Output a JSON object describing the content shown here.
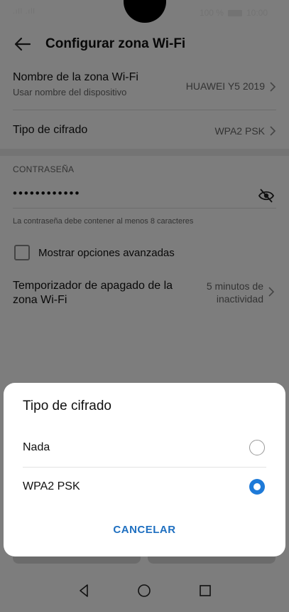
{
  "status": {
    "signal": ".ıll .ıll",
    "battery": "100 %",
    "time": "10:00"
  },
  "appbar": {
    "title": "Configurar zona Wi-Fi"
  },
  "hotspot_name": {
    "label": "Nombre de la zona Wi-Fi",
    "sub": "Usar nombre del dispositivo",
    "value": "HUAWEI Y5 2019"
  },
  "encryption": {
    "label": "Tipo de cifrado",
    "value": "WPA2 PSK"
  },
  "password": {
    "section": "CONTRASEÑA",
    "masked": "••••••••••••",
    "hint": "La contraseña debe contener al menos 8 caracteres"
  },
  "advanced": {
    "label": "Mostrar opciones avanzadas",
    "checked": false
  },
  "timer": {
    "label": "Temporizador de apagado de la zona Wi-Fi",
    "value": "5 minutos de inactividad"
  },
  "dialog": {
    "title": "Tipo de cifrado",
    "options": [
      {
        "label": "Nada",
        "selected": false
      },
      {
        "label": "WPA2 PSK",
        "selected": true
      }
    ],
    "cancel_label": "CANCELAR"
  },
  "colors": {
    "accent": "#1e7ad8",
    "cancel": "#1e6fc0"
  },
  "navbar": {
    "icons": [
      "back-triangle-icon",
      "home-circle-icon",
      "recents-square-icon"
    ]
  }
}
